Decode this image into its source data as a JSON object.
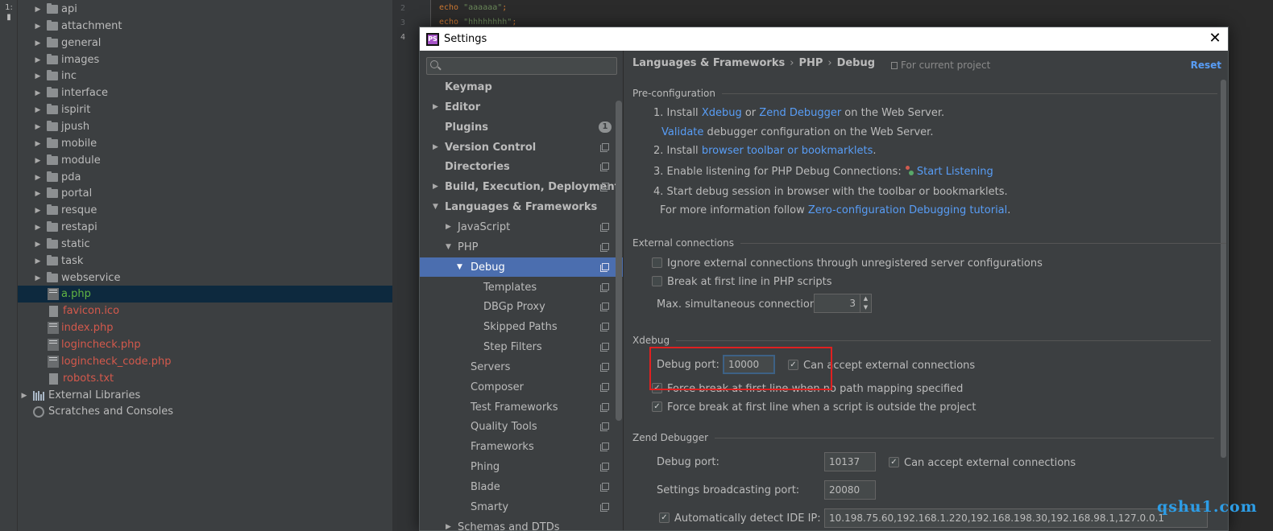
{
  "project_tree": {
    "items": [
      {
        "label": "api",
        "type": "folder"
      },
      {
        "label": "attachment",
        "type": "folder"
      },
      {
        "label": "general",
        "type": "folder"
      },
      {
        "label": "images",
        "type": "folder"
      },
      {
        "label": "inc",
        "type": "folder"
      },
      {
        "label": "interface",
        "type": "folder"
      },
      {
        "label": "ispirit",
        "type": "folder"
      },
      {
        "label": "jpush",
        "type": "folder"
      },
      {
        "label": "mobile",
        "type": "folder"
      },
      {
        "label": "module",
        "type": "folder"
      },
      {
        "label": "pda",
        "type": "folder"
      },
      {
        "label": "portal",
        "type": "folder"
      },
      {
        "label": "resque",
        "type": "folder"
      },
      {
        "label": "restapi",
        "type": "folder"
      },
      {
        "label": "static",
        "type": "folder"
      },
      {
        "label": "task",
        "type": "folder"
      },
      {
        "label": "webservice",
        "type": "folder"
      },
      {
        "label": "a.php",
        "type": "php"
      },
      {
        "label": "favicon.ico",
        "type": "file"
      },
      {
        "label": "index.php",
        "type": "php"
      },
      {
        "label": "logincheck.php",
        "type": "php"
      },
      {
        "label": "logincheck_code.php",
        "type": "php"
      },
      {
        "label": "robots.txt",
        "type": "file"
      },
      {
        "label": "External Libraries",
        "type": "libs"
      },
      {
        "label": "Scratches and Consoles",
        "type": "scratch"
      }
    ],
    "selected": "a.php",
    "colors": {
      "modified": "#d4594c",
      "added": "#62b543",
      "normal": "#bbbbbb"
    }
  },
  "editor": {
    "line_numbers": [
      "2",
      "3",
      "4"
    ],
    "lines": [
      {
        "keyword": "echo ",
        "string": "\"aaaaaa\"",
        "end": ";"
      },
      {
        "keyword": "echo ",
        "string": "\"hhhhhhhh\"",
        "end": ";"
      }
    ]
  },
  "settings": {
    "title": "Settings",
    "logo_text": "PS",
    "search": {
      "value": "",
      "placeholder": ""
    },
    "nav": [
      {
        "label": "Keymap",
        "bold": true
      },
      {
        "label": "Editor",
        "bold": true,
        "arrow": "right"
      },
      {
        "label": "Plugins",
        "bold": true,
        "badge": "1"
      },
      {
        "label": "Version Control",
        "bold": true,
        "arrow": "right"
      },
      {
        "label": "Directories",
        "bold": true
      },
      {
        "label": "Build, Execution, Deployment",
        "bold": true,
        "arrow": "right"
      },
      {
        "label": "Languages & Frameworks",
        "bold": true,
        "arrow": "down"
      },
      {
        "label": "JavaScript",
        "arrow": "right"
      },
      {
        "label": "PHP",
        "arrow": "down"
      },
      {
        "label": "Debug",
        "arrow": "down",
        "selected": true
      },
      {
        "label": "Templates"
      },
      {
        "label": "DBGp Proxy"
      },
      {
        "label": "Skipped Paths"
      },
      {
        "label": "Step Filters"
      },
      {
        "label": "Servers"
      },
      {
        "label": "Composer"
      },
      {
        "label": "Test Frameworks"
      },
      {
        "label": "Quality Tools"
      },
      {
        "label": "Frameworks"
      },
      {
        "label": "Phing"
      },
      {
        "label": "Blade"
      },
      {
        "label": "Smarty"
      },
      {
        "label": "Schemas and DTDs",
        "arrow": "right"
      }
    ],
    "breadcrumb": [
      "Languages & Frameworks",
      "PHP",
      "Debug"
    ],
    "breadcrumb_sep": "›",
    "scope": "For current project",
    "reset": "Reset",
    "preconfig": {
      "title": "Pre-configuration",
      "s1_prefix": "1. Install ",
      "s1_xdebug": "Xdebug",
      "s1_or": " or ",
      "s1_zend": "Zend Debugger",
      "s1_suffix": " on the Web Server.",
      "s1b_validate": "Validate",
      "s1b_suffix": " debugger configuration on the Web Server.",
      "s2_prefix": "2. Install ",
      "s2_link": "browser toolbar or bookmarklets",
      "s2_suffix": ".",
      "s3_prefix": "3. Enable listening for PHP Debug Connections: ",
      "s3_link": "Start Listening",
      "s4": "4. Start debug session in browser with the toolbar or bookmarklets.",
      "s4b_prefix": "For more information follow ",
      "s4b_link": "Zero-configuration Debugging tutorial",
      "s4b_suffix": "."
    },
    "external": {
      "title": "External connections",
      "ignore_label": "Ignore external connections through unregistered server configurations",
      "ignore_checked": false,
      "break_label": "Break at first line in PHP scripts",
      "break_checked": false,
      "max_label": "Max. simultaneous connections:",
      "max_value": "3"
    },
    "xdebug": {
      "title": "Xdebug",
      "port_label": "Debug port:",
      "port_value": "10000",
      "accept_label": "Can accept external connections",
      "accept_checked": true,
      "force_nopath_label": "Force break at first line when no path mapping specified",
      "force_nopath_checked": true,
      "force_outside_label": "Force break at first line when a script is outside the project",
      "force_outside_checked": true
    },
    "zend": {
      "title": "Zend Debugger",
      "port_label": "Debug port:",
      "port_value": "10137",
      "accept_label": "Can accept external connections",
      "accept_checked": true,
      "broadcast_label": "Settings broadcasting port:",
      "broadcast_value": "20080",
      "detect_label": "Automatically detect IDE IP:",
      "detect_checked": true,
      "detect_value": "10.198.75.60,192.168.1.220,192.168.198.30,192.168.98.1,127.0.0.1"
    }
  },
  "check_mark": "✓",
  "watermark": "qshu1.com"
}
